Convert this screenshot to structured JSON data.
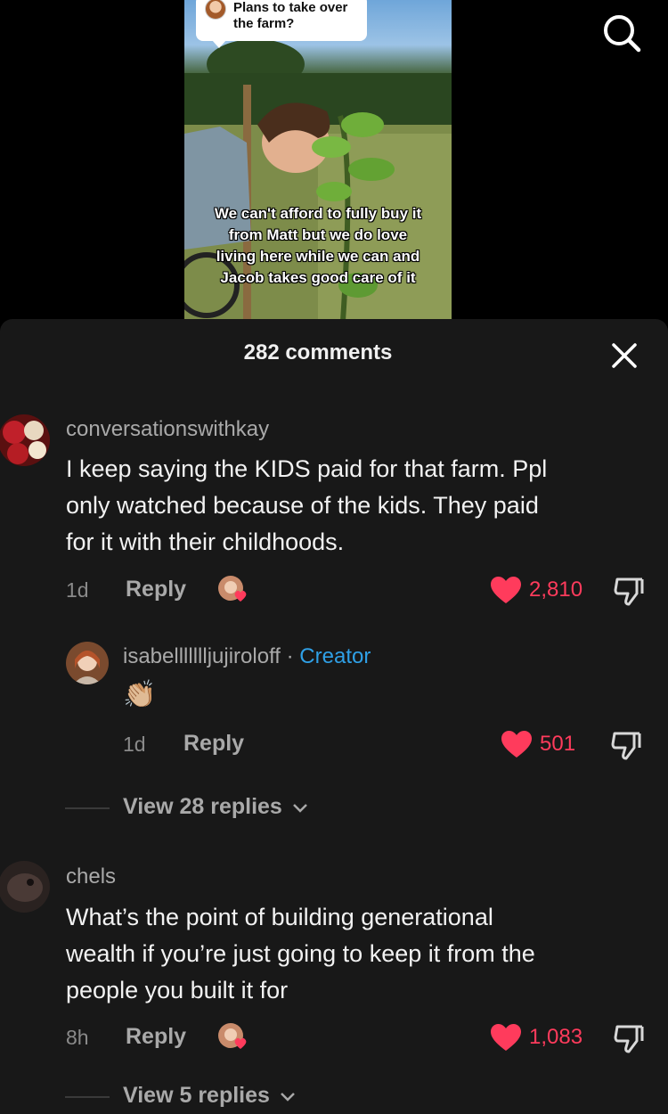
{
  "video": {
    "bubble_text": "Plans to take over the farm?",
    "caption_lines": [
      "We can't afford to fully buy it",
      "from Matt but we do love",
      "living here while we can and",
      "Jacob takes good care of it"
    ]
  },
  "header": {
    "title": "282 comments"
  },
  "comments": [
    {
      "username": "conversationswithkay",
      "text_lines": [
        "I keep saying the KIDS paid for that farm. Ppl",
        "only watched because of the kids. They paid",
        "for it with their childhoods."
      ],
      "time": "1d",
      "reply_label": "Reply",
      "likes": "2,810",
      "reply": {
        "username": "isabellllllljujiroloff",
        "separator": " · ",
        "badge": "Creator",
        "text": "👏🏼",
        "time": "1d",
        "reply_label": "Reply",
        "likes": "501"
      },
      "view_replies": "View 28 replies"
    },
    {
      "username": "chels",
      "text_lines": [
        "What’s the point of building generational",
        "wealth if you’re just going to keep it from the",
        "people you built it for"
      ],
      "time": "8h",
      "reply_label": "Reply",
      "likes": "1,083",
      "view_replies": "View 5 replies"
    }
  ],
  "icons": {
    "search": "search-icon",
    "close": "close-icon",
    "heart": "heart-icon",
    "dislike": "thumbs-down-icon",
    "chevron": "chevron-down-icon"
  },
  "colors": {
    "like": "#ff3b5c",
    "creator_badge": "#2fa0e6",
    "sheet_bg": "#181818"
  }
}
